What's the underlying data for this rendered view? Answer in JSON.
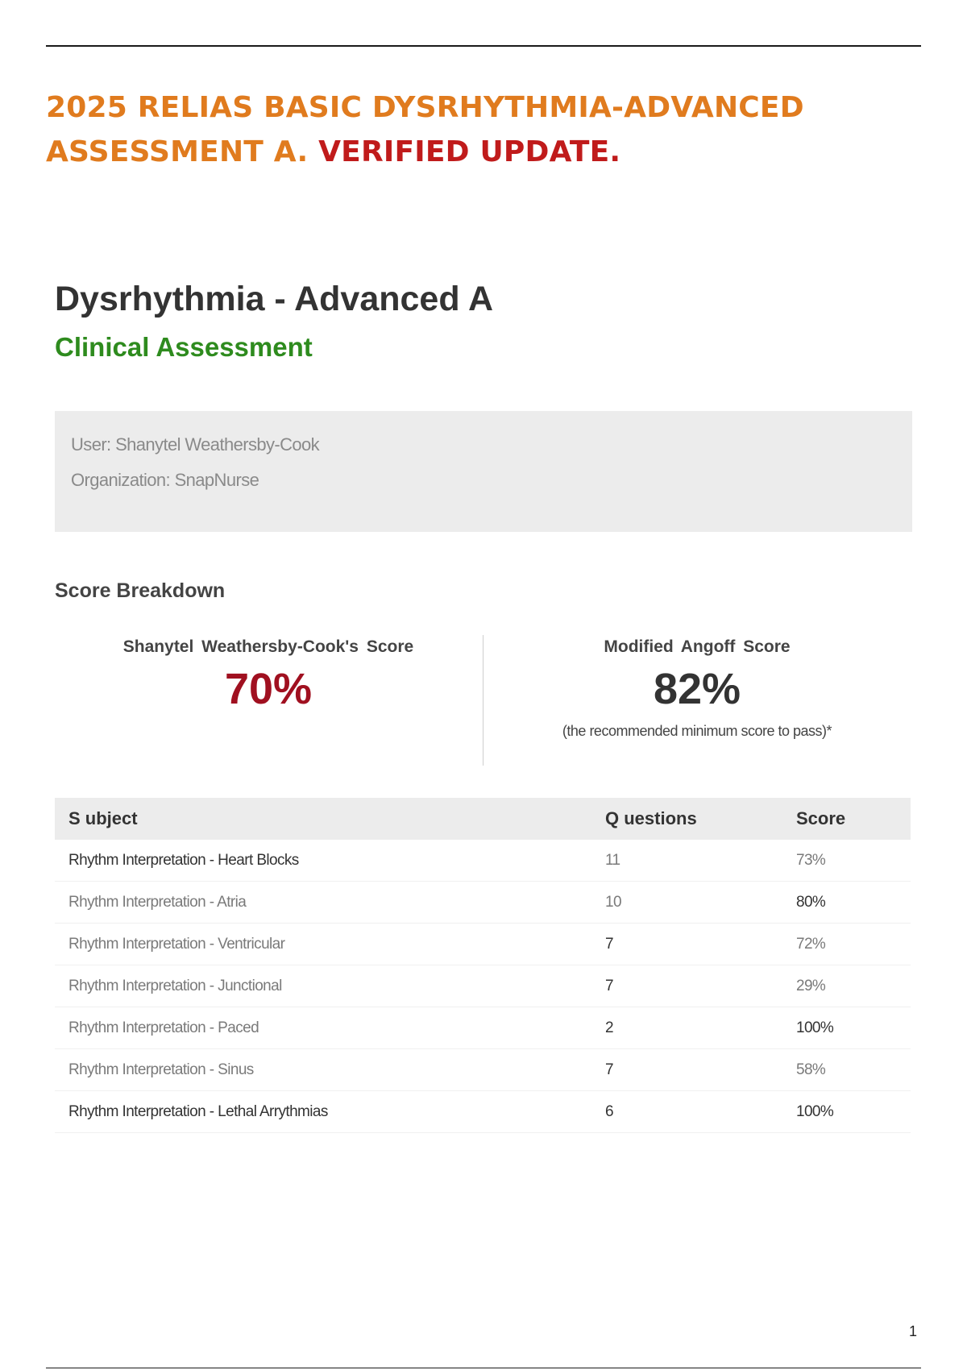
{
  "document": {
    "title_part1": "2025 RELIAS BASIC DYSRHYTHMIA-ADVANCED ASSESSMENT A.",
    "title_part2": "VERIFIED UPDATE.",
    "page_number": "1"
  },
  "assessment": {
    "title": "Dysrhythmia - Advanced A",
    "subtitle": "Clinical Assessment"
  },
  "info": {
    "user": "User: Shanytel Weathersby-Cook",
    "organization": "Organization: SnapNurse"
  },
  "score_breakdown": {
    "heading": "Score Breakdown",
    "user_score_label": "Shanytel Weathersby-Cook's Score",
    "user_score": "70%",
    "angoff_label": "Modified Angoff Score",
    "angoff_score": "82%",
    "angoff_note": "(the recommended minimum score to pass)*"
  },
  "table": {
    "headers": [
      "S ubject",
      "Q uestions",
      "Score"
    ],
    "rows": [
      {
        "subject": "Rhythm Interpretation - Heart Blocks",
        "questions": "11",
        "score": "73%"
      },
      {
        "subject": "Rhythm Interpretation - Atria",
        "questions": "10",
        "score": "80%"
      },
      {
        "subject": "Rhythm Interpretation - Ventricular",
        "questions": "7",
        "score": "72%"
      },
      {
        "subject": "Rhythm Interpretation - Junctional",
        "questions": "7",
        "score": "29%"
      },
      {
        "subject": "Rhythm Interpretation - Paced",
        "questions": "2",
        "score": "100%"
      },
      {
        "subject": "Rhythm Interpretation - Sinus",
        "questions": "7",
        "score": "58%"
      },
      {
        "subject": "Rhythm Interpretation - Lethal Arrythmias",
        "questions": "6",
        "score": "100%"
      }
    ]
  }
}
